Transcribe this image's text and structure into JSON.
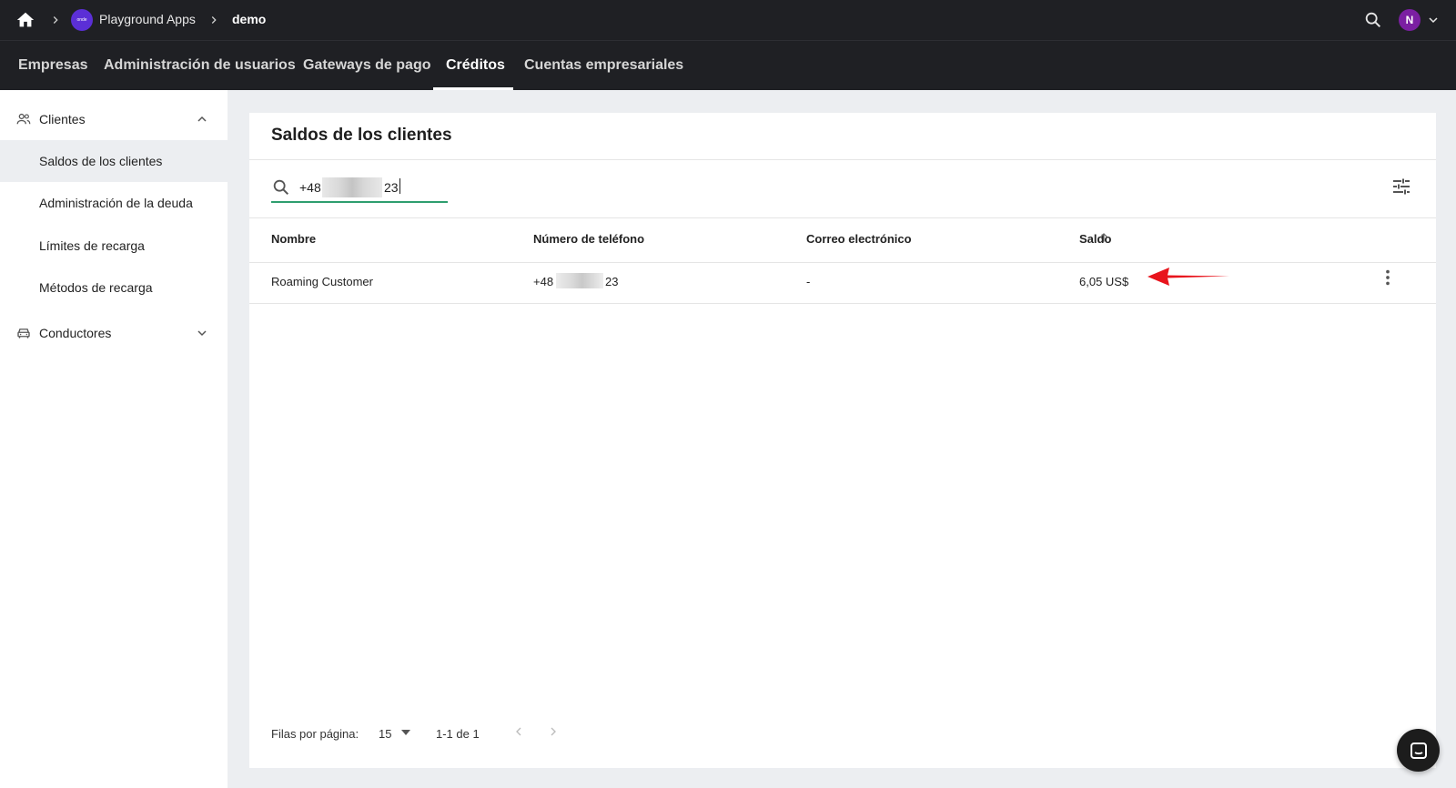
{
  "breadcrumb": {
    "app_logo_text": "onde",
    "app_name": "Playground Apps",
    "current": "demo"
  },
  "user": {
    "avatar_initial": "N"
  },
  "nav": {
    "tabs": [
      {
        "label": "Empresas"
      },
      {
        "label": "Administración de usuarios"
      },
      {
        "label": "Gateways de pago"
      },
      {
        "label": "Créditos"
      },
      {
        "label": "Cuentas empresariales"
      }
    ],
    "active": "Créditos"
  },
  "sidebar": {
    "groups": [
      {
        "label": "Clientes",
        "icon": "people-icon",
        "expanded": true,
        "items": [
          {
            "label": "Saldos de los clientes"
          },
          {
            "label": "Administración de la deuda"
          },
          {
            "label": "Límites de recarga"
          },
          {
            "label": "Métodos de recarga"
          }
        ]
      },
      {
        "label": "Conductores",
        "icon": "car-icon",
        "expanded": false
      }
    ],
    "active_item": "Saldos de los clientes"
  },
  "main": {
    "title": "Saldos de los clientes",
    "search": {
      "value_prefix": "+48",
      "value_suffix": "23"
    },
    "table": {
      "columns": [
        "Nombre",
        "Número de teléfono",
        "Correo electrónico",
        "Saldo"
      ],
      "sorted_by": "Saldo",
      "rows": [
        {
          "name": "Roaming Customer",
          "phone_prefix": "+48",
          "phone_suffix": "23",
          "email": "-",
          "balance": "6,05 US$"
        }
      ]
    },
    "pagination": {
      "rows_per_page_label": "Filas por página:",
      "rows_per_page": "15",
      "range": "1-1 de 1"
    }
  },
  "colors": {
    "topbar": "#1f2024",
    "accent_green": "#2e9e6e",
    "annotation_arrow": "#e8141c",
    "avatar": "#7b1fa2",
    "app_logo": "#5b2fd6"
  }
}
